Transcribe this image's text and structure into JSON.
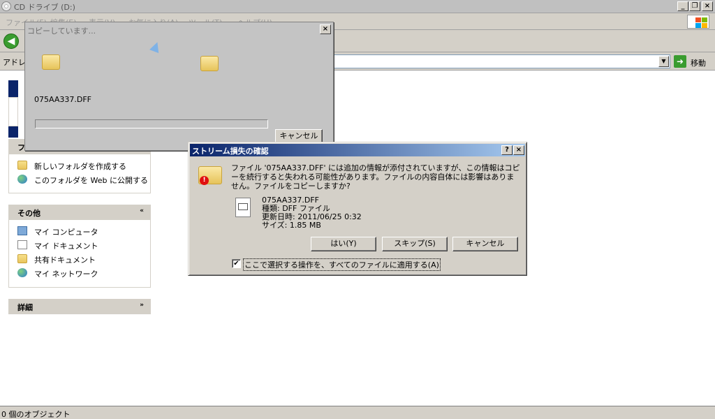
{
  "window": {
    "title": "CD ドライブ (D:)",
    "menu": [
      "ファイル(F)",
      "編集(E)",
      "表示(V)",
      "お気に入り(A)",
      "ツール(T)",
      "ヘルプ(H)"
    ],
    "minimize_glyph": "_",
    "restore_glyph": "❐",
    "close_glyph": "×"
  },
  "toolbar": {
    "back_glyph": "◀"
  },
  "address": {
    "label": "アドレス",
    "go_label": "移動",
    "go_glyph": "➜",
    "drop_glyph": "▼"
  },
  "task_pane": {
    "panels": [
      {
        "title": "ファイルとフォルダのタスク",
        "items": [
          "新しいフォルダを作成する",
          "このフォルダを Web に公開する"
        ]
      },
      {
        "title": "その他",
        "items": [
          "マイ コンピュータ",
          "マイ ドキュメント",
          "共有ドキュメント",
          "マイ ネットワーク"
        ]
      },
      {
        "title": "詳細",
        "items": []
      }
    ],
    "collapse_glyph": "«",
    "expand_glyph": "»"
  },
  "status_bar": {
    "text": "0 個のオブジェクト"
  },
  "copy_dialog": {
    "title": "コピーしています...",
    "file_name": "075AA337.DFF",
    "progress": 0,
    "cancel_label": "キャンセル",
    "close_glyph": "×"
  },
  "stream_dialog": {
    "title": "ストリーム損失の確認",
    "help_glyph": "?",
    "close_glyph": "×",
    "message": "ファイル '075AA337.DFF' には追加の情報が添付されていますが、この情報はコピーを続行すると失われる可能性があります。ファイルの内容自体には影響はありません。ファイルをコピーしますか?",
    "file": {
      "name": "075AA337.DFF",
      "type": "種類: DFF ファイル",
      "modified": "更新日時: 2011/06/25 0:32",
      "size": "サイズ: 1.85 MB"
    },
    "buttons": {
      "yes": "はい(Y)",
      "skip": "スキップ(S)",
      "cancel": "キャンセル"
    },
    "apply_all": {
      "checked": true,
      "label": "ここで選択する操作を、すべてのファイルに適用する(A)",
      "check_glyph": "✔"
    },
    "error_glyph": "!"
  },
  "colors": {
    "title_active": "#0a246a",
    "title_gradient_end": "#a6caf0",
    "face": "#d4d0c8"
  }
}
